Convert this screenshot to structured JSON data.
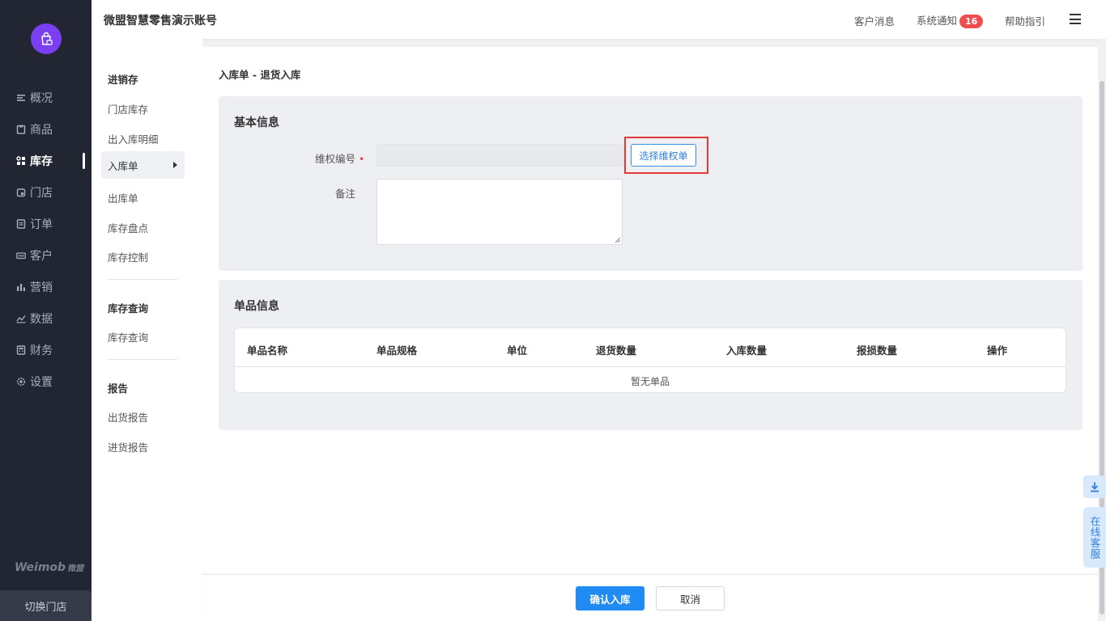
{
  "header": {
    "title": "微盟智慧零售演示账号",
    "messages": "客户消息",
    "notices": "系统通知",
    "notices_count": "16",
    "help": "帮助指引"
  },
  "sidebar": {
    "items": [
      {
        "label": "概况",
        "icon": "overview-icon"
      },
      {
        "label": "商品",
        "icon": "goods-icon"
      },
      {
        "label": "库存",
        "icon": "inventory-icon"
      },
      {
        "label": "门店",
        "icon": "store-icon"
      },
      {
        "label": "订单",
        "icon": "order-icon"
      },
      {
        "label": "客户",
        "icon": "customer-icon"
      },
      {
        "label": "营销",
        "icon": "marketing-icon"
      },
      {
        "label": "数据",
        "icon": "data-icon"
      },
      {
        "label": "财务",
        "icon": "finance-icon"
      },
      {
        "label": "设置",
        "icon": "settings-icon"
      }
    ],
    "brand": "Weimob",
    "brand_cn": "微盟",
    "switch_store": "切换门店"
  },
  "submenu": {
    "group1": "进销存",
    "group1_items": [
      "门店库存",
      "出入库明细",
      "入库单",
      "出库单",
      "库存盘点",
      "库存控制"
    ],
    "group2": "库存查询",
    "group2_items": [
      "库存查询"
    ],
    "group3": "报告",
    "group3_items": [
      "出货报告",
      "进货报告"
    ]
  },
  "main": {
    "breadcrumb": "入库单 - 退货入库",
    "basic": {
      "title": "基本信息",
      "rights_label": "维权编号",
      "rights_required": "•",
      "select_button": "选择维权单",
      "remark_label": "备注"
    },
    "items": {
      "title": "单品信息",
      "columns": [
        "单品名称",
        "单品规格",
        "单位",
        "退货数量",
        "入库数量",
        "报损数量",
        "操作"
      ],
      "empty": "暂无单品"
    }
  },
  "footer": {
    "confirm": "确认入库",
    "cancel": "取消"
  },
  "float": {
    "service": "在线客服"
  },
  "colors": {
    "sidebar_bg": "#222633",
    "accent": "#1f8bf3",
    "logo": "#7b3ff2",
    "badge": "#f04e4e",
    "highlight": "#e53935"
  }
}
